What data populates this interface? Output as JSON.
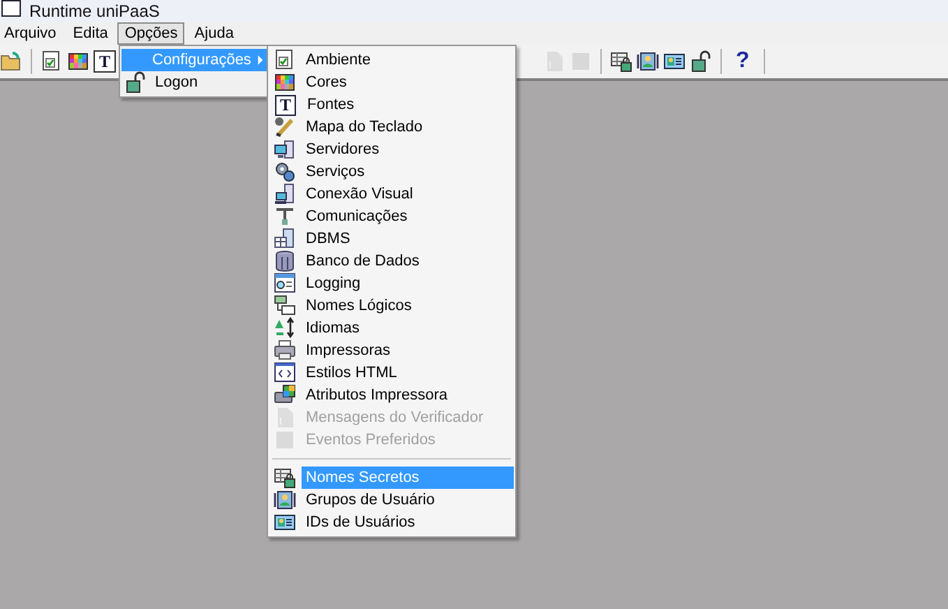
{
  "window": {
    "title": "Runtime uniPaaS"
  },
  "menubar": [
    {
      "label": "Arquivo",
      "selected": false
    },
    {
      "label": "Edita",
      "selected": false
    },
    {
      "label": "Opções",
      "selected": true
    },
    {
      "label": "Ajuda",
      "selected": false
    }
  ],
  "toolbar_left": [
    {
      "kind": "icon",
      "disabled": false
    },
    {
      "kind": "separator"
    },
    {
      "kind": "icon",
      "disabled": false
    },
    {
      "kind": "icon",
      "disabled": false
    },
    {
      "kind": "glyph",
      "text": "T",
      "disabled": false
    }
  ],
  "toolbar_right": [
    {
      "kind": "icon",
      "disabled": true
    },
    {
      "kind": "icon",
      "disabled": true
    },
    {
      "kind": "separator"
    },
    {
      "kind": "icon",
      "disabled": false
    },
    {
      "kind": "icon",
      "disabled": false
    },
    {
      "kind": "icon",
      "disabled": false
    },
    {
      "kind": "icon",
      "disabled": false
    },
    {
      "kind": "separator"
    },
    {
      "kind": "glyph",
      "text": "?",
      "disabled": false
    },
    {
      "kind": "separator"
    }
  ],
  "options_menu": [
    {
      "label": "Configurações",
      "selected": true,
      "submenu": true
    },
    {
      "label": "Logon",
      "selected": false,
      "submenu": false
    }
  ],
  "settings_submenu": [
    {
      "kind": "item",
      "label": "Ambiente",
      "selected": false,
      "disabled": false
    },
    {
      "kind": "item",
      "label": "Cores",
      "selected": false,
      "disabled": false
    },
    {
      "kind": "item",
      "label": "Fontes",
      "selected": false,
      "disabled": false,
      "icon_text": "T"
    },
    {
      "kind": "item",
      "label": "Mapa do Teclado",
      "selected": false,
      "disabled": false
    },
    {
      "kind": "item",
      "label": "Servidores",
      "selected": false,
      "disabled": false
    },
    {
      "kind": "item",
      "label": "Serviços",
      "selected": false,
      "disabled": false
    },
    {
      "kind": "item",
      "label": "Conexão Visual",
      "selected": false,
      "disabled": false
    },
    {
      "kind": "item",
      "label": "Comunicações",
      "selected": false,
      "disabled": false
    },
    {
      "kind": "item",
      "label": "DBMS",
      "selected": false,
      "disabled": false
    },
    {
      "kind": "item",
      "label": "Banco de Dados",
      "selected": false,
      "disabled": false
    },
    {
      "kind": "item",
      "label": "Logging",
      "selected": false,
      "disabled": false
    },
    {
      "kind": "item",
      "label": "Nomes Lógicos",
      "selected": false,
      "disabled": false
    },
    {
      "kind": "item",
      "label": "Idiomas",
      "selected": false,
      "disabled": false
    },
    {
      "kind": "item",
      "label": "Impressoras",
      "selected": false,
      "disabled": false
    },
    {
      "kind": "item",
      "label": "Estilos HTML",
      "selected": false,
      "disabled": false
    },
    {
      "kind": "item",
      "label": "Atributos Impressora",
      "selected": false,
      "disabled": false
    },
    {
      "kind": "item",
      "label": "Mensagens do Verificador",
      "selected": false,
      "disabled": true
    },
    {
      "kind": "item",
      "label": "Eventos Preferidos",
      "selected": false,
      "disabled": true
    },
    {
      "kind": "separator"
    },
    {
      "kind": "item",
      "label": "Nomes Secretos",
      "selected": true,
      "disabled": false
    },
    {
      "kind": "item",
      "label": "Grupos de Usuário",
      "selected": false,
      "disabled": false
    },
    {
      "kind": "item",
      "label": "IDs de Usuários",
      "selected": false,
      "disabled": false
    }
  ]
}
